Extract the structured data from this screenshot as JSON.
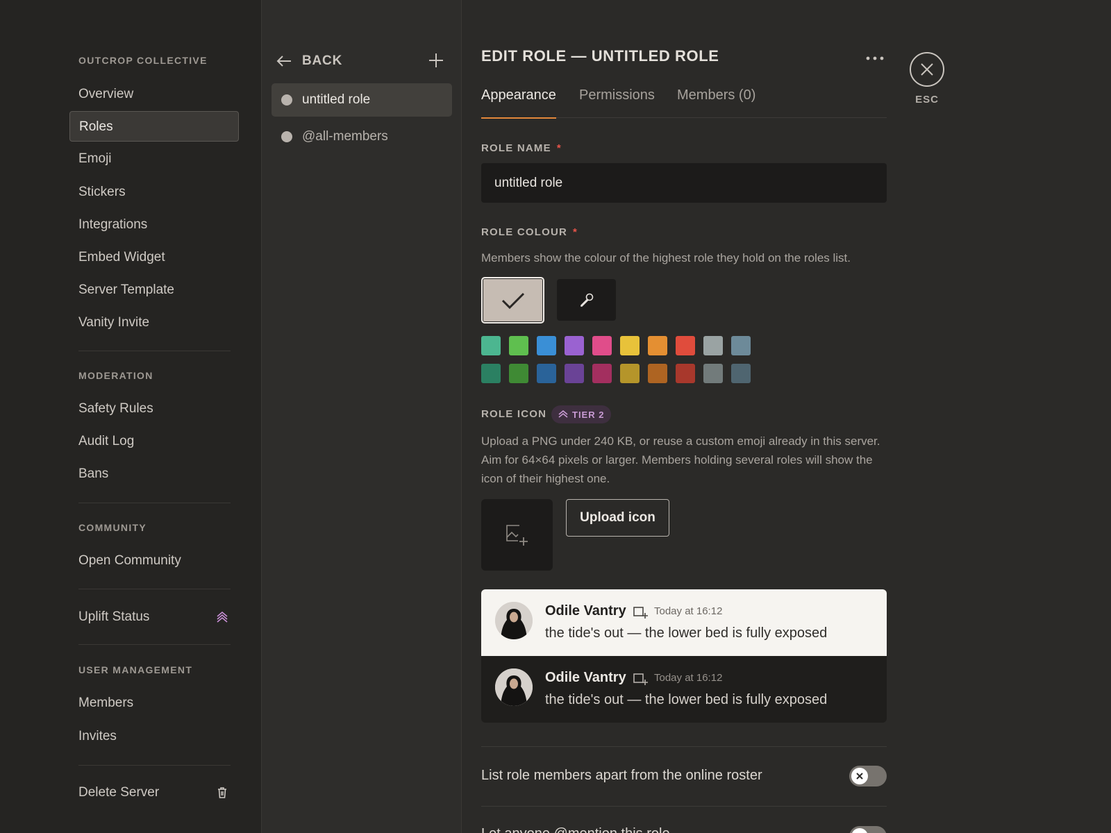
{
  "sidebar": {
    "server_heading": "OUTCROP COLLECTIVE",
    "server_items": [
      {
        "label": "Overview"
      },
      {
        "label": "Roles"
      },
      {
        "label": "Emoji"
      },
      {
        "label": "Stickers"
      },
      {
        "label": "Integrations"
      },
      {
        "label": "Embed Widget"
      },
      {
        "label": "Server Template"
      },
      {
        "label": "Vanity Invite"
      }
    ],
    "moderation_heading": "MODERATION",
    "moderation_items": [
      {
        "label": "Safety Rules"
      },
      {
        "label": "Audit Log"
      },
      {
        "label": "Bans"
      }
    ],
    "community_heading": "COMMUNITY",
    "community_items": [
      {
        "label": "Open Community"
      }
    ],
    "uplift_label": "Uplift Status",
    "user_management_heading": "USER MANAGEMENT",
    "user_management_items": [
      {
        "label": "Members"
      },
      {
        "label": "Invites"
      }
    ],
    "delete_label": "Delete Server"
  },
  "roles_panel": {
    "back_label": "BACK",
    "roles": [
      {
        "name": "untitled role"
      },
      {
        "name": "@all-members"
      }
    ]
  },
  "editor": {
    "title": "EDIT ROLE — UNTITLED ROLE",
    "tabs": [
      {
        "label": "Appearance"
      },
      {
        "label": "Permissions"
      },
      {
        "label": "Members (0)"
      }
    ],
    "role_name_label": "ROLE NAME",
    "role_name_value": "untitled role",
    "role_colour_label": "ROLE COLOUR",
    "role_colour_help": "Members show the colour of the highest role they hold on the roles list.",
    "selected_colour": "#c6bcb3",
    "swatches_row1": [
      "#4cb690",
      "#5fbf4f",
      "#3a8fd6",
      "#9a62d1",
      "#e04d8a",
      "#e8c23a",
      "#e48f32",
      "#e04c3c",
      "#9aa3a3",
      "#6d8a99"
    ],
    "swatches_row2": [
      "#2b8062",
      "#3f8a34",
      "#2a6399",
      "#6a4396",
      "#a32f5f",
      "#b5952a",
      "#ae6422",
      "#a8382c",
      "#727b7b",
      "#4f6570"
    ],
    "role_icon_label": "ROLE ICON",
    "tier_badge": "TIER 2",
    "role_icon_help": "Upload a PNG under 240 KB, or reuse a custom emoji already in this server. Aim for 64×64 pixels or larger. Members holding several roles will show the icon of their highest one.",
    "upload_label": "Upload icon",
    "preview": {
      "name": "Odile Vantry",
      "time": "Today at 16:12",
      "text": "the tide's out — the lower bed is fully exposed"
    },
    "toggle1_label": "List role members apart from the online roster",
    "toggle2_label": "Let anyone @mention this role"
  },
  "close": {
    "esc_label": "ESC"
  }
}
